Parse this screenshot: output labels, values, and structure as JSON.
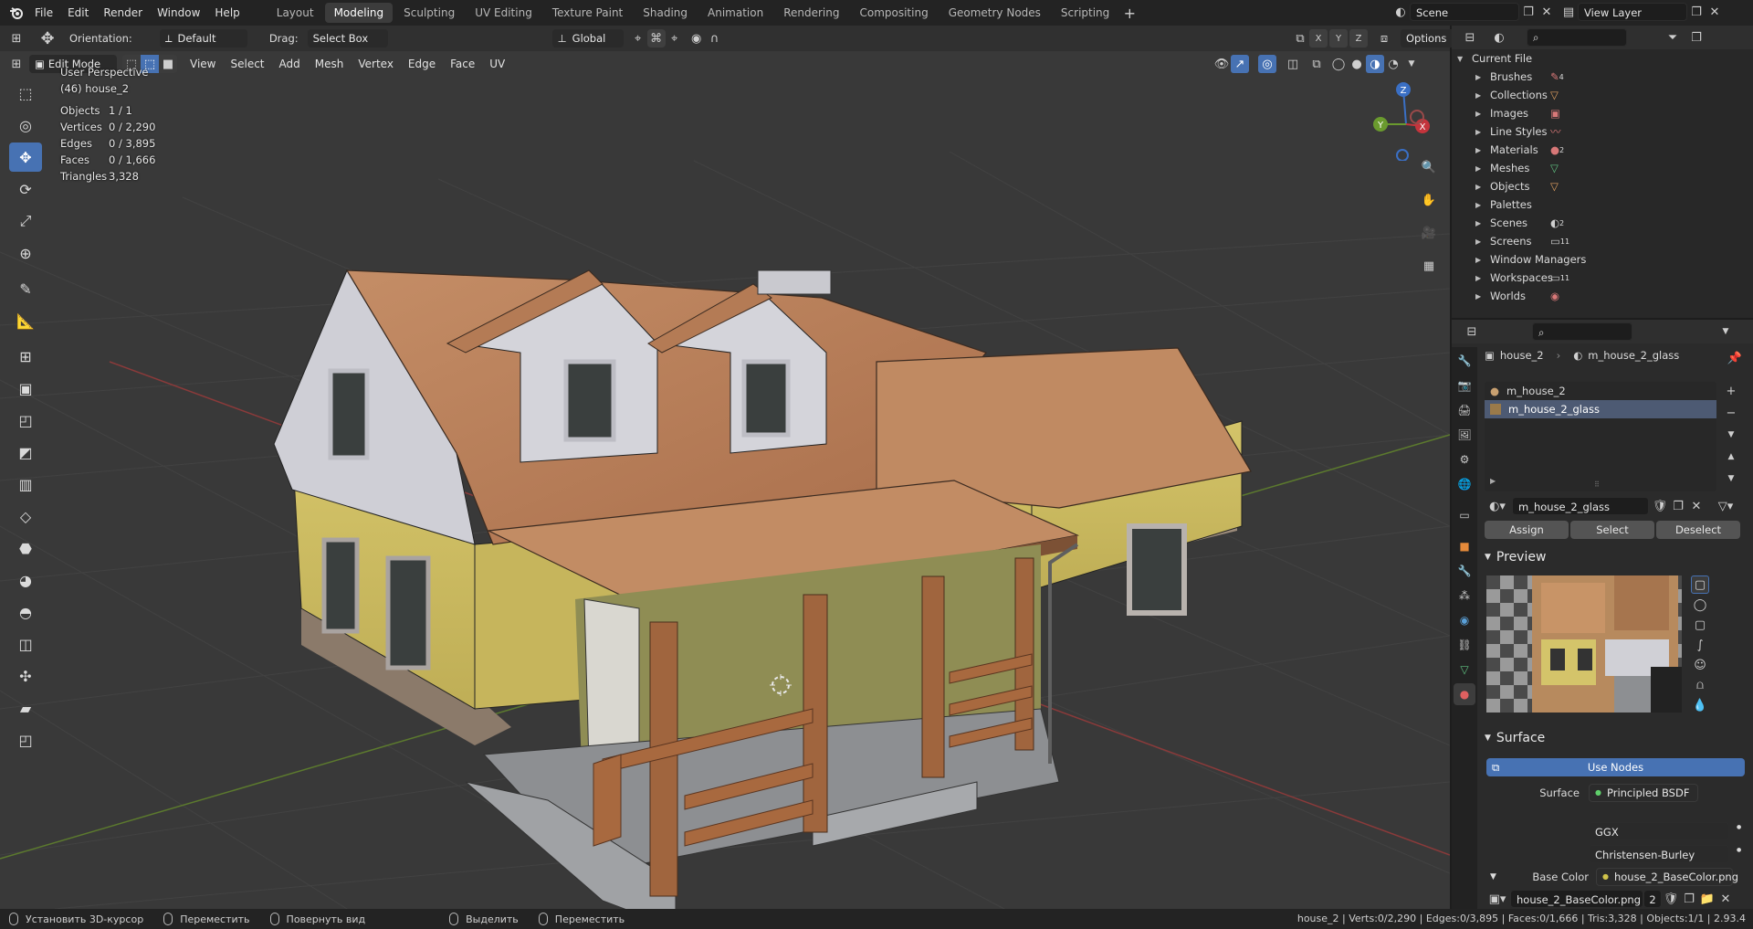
{
  "menu": [
    "File",
    "Edit",
    "Render",
    "Window",
    "Help"
  ],
  "workspaces": [
    "Layout",
    "Modeling",
    "Sculpting",
    "UV Editing",
    "Texture Paint",
    "Shading",
    "Animation",
    "Rendering",
    "Compositing",
    "Geometry Nodes",
    "Scripting"
  ],
  "active_workspace": "Modeling",
  "scene_name": "Scene",
  "view_layer": "View Layer",
  "tool_header": {
    "orientation_label": "Orientation:",
    "orientation_value": "Default",
    "drag_label": "Drag:",
    "drag_value": "Select Box",
    "transform_orientation": "Global",
    "options_label": "Options"
  },
  "vp_header": {
    "mode": "Edit Mode",
    "menus": [
      "View",
      "Select",
      "Add",
      "Mesh",
      "Vertex",
      "Edge",
      "Face",
      "UV"
    ]
  },
  "overlay": {
    "perspective": "User Perspective",
    "object": "(46) house_2",
    "stats": [
      {
        "label": "Objects",
        "value": "1 / 1"
      },
      {
        "label": "Vertices",
        "value": "0 / 2,290"
      },
      {
        "label": "Edges",
        "value": "0 / 3,895"
      },
      {
        "label": "Faces",
        "value": "0 / 1,666"
      },
      {
        "label": "Triangles",
        "value": "3,328"
      }
    ]
  },
  "gizmo": {
    "z": "Z",
    "y": "Y",
    "x": "X"
  },
  "outliner": {
    "root": "Current File",
    "items": [
      "Brushes",
      "Collections",
      "Images",
      "Line Styles",
      "Materials",
      "Meshes",
      "Objects",
      "Palettes",
      "Scenes",
      "Screens",
      "Window Managers",
      "Workspaces",
      "Worlds"
    ],
    "badges": {
      "Brushes": "4",
      "Materials": "2",
      "Scenes": "2",
      "Screens": "11",
      "Workspaces": "11"
    }
  },
  "properties": {
    "breadcrumb_object": "house_2",
    "breadcrumb_material": "m_house_2_glass",
    "material_slots": [
      "m_house_2",
      "m_house_2_glass"
    ],
    "active_material": "m_house_2_glass",
    "buttons": {
      "assign": "Assign",
      "select": "Select",
      "deselect": "Deselect"
    },
    "preview_title": "Preview",
    "surface_title": "Surface",
    "use_nodes": "Use Nodes",
    "surface_label": "Surface",
    "surface_value": "Principled BSDF",
    "distribution": "GGX",
    "subsurface_method": "Christensen-Burley",
    "base_color_label": "Base Color",
    "base_color_value": "house_2_BaseColor.png",
    "image_name": "house_2_BaseColor.png",
    "image_users": "2"
  },
  "statusbar": {
    "left": [
      "Установить 3D-курсор",
      "Переместить",
      "Повернуть вид",
      "Выделить",
      "Переместить"
    ],
    "right": "house_2 | Verts:0/2,290 | Edges:0/3,895 | Faces:0/1,666 | Tris:3,328 | Objects:1/1 | 2.93.4"
  },
  "colors": {
    "accent": "#4772b3",
    "roof": "#b9805a",
    "wall": "#cfc060",
    "trim": "#a0653e"
  }
}
